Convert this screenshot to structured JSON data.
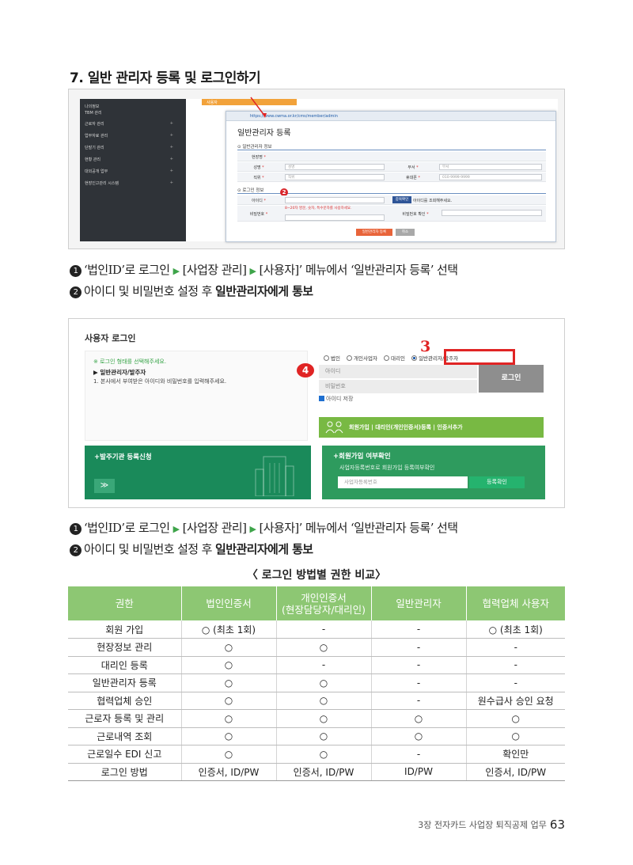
{
  "section_title": "7. 일반 관리자 등록 및 로그인하기",
  "shot1": {
    "sidebar_items": [
      "나의정보",
      "TBM 관리",
      "근로자 관리",
      "업무자료 관리",
      "단말기 관리",
      "현황 관리",
      "대외공개 업무",
      "현장인고관리 시스템"
    ],
    "tab_label": "사용자",
    "url": "https://www.cwma.or.kr/cms/member/admin",
    "window_title": "일반관리자 등록",
    "sec_general": "⊙ 일반관리자 정보",
    "sec_login": "⊙ 로그인 정보",
    "labels": {
      "site": "현장명",
      "name": "성명",
      "dept": "부서",
      "position": "직위",
      "phone": "휴대폰",
      "id": "아이디",
      "password": "비밀번호",
      "password_confirm": "비밀번호 확인"
    },
    "placeholders": {
      "name": "성명",
      "dept": "부서",
      "position": "직위",
      "phone": "010-9999-9999"
    },
    "dup_check": "중복확인",
    "dup_hint": "아이디를 조회해주세요.",
    "pw_rule": "8~20자 영문, 숫자, 특수문자를 사용하세요.",
    "register_button": "일반관리자 등록",
    "cancel_button": "취소",
    "badge2": "2"
  },
  "steps_a": {
    "s1_num": "1",
    "s1_pre": "‘법인ID’로 로그인 ",
    "s1_mid1": " [사업장 관리] ",
    "s1_mid2": " [사용자]’ 메뉴에서 ‘일반관리자 등록’ 선택",
    "s2_num": "2",
    "s2_pre": "아이디 및 비밀번호 설정 후 ",
    "s2_bold": "일반관리자에게 통보"
  },
  "shot2": {
    "title": "사용자 로그인",
    "info_hint": "※ 로그인 형태를 선택해주세요.",
    "info_type": "▶ 일반관리자/발주자",
    "info_desc": "1. 본사에서 부여받은 아이디와 비밀번호를 입력해주세요.",
    "radios": [
      "법인",
      "개인사업자",
      "대리인",
      "일반관리자/발주자"
    ],
    "num3": "3",
    "num4": "4",
    "id_placeholder": "아이디",
    "pw_placeholder": "비밀번호",
    "login_button": "로그인",
    "save_id": "아이디 저장",
    "join_bar": "회원가입 | 대리인(개인인증서)등록 | 인증서추가",
    "order_register": "+발주기관 등록신청",
    "arrow": "≫",
    "join_check_title": "+회원가입 여부확인",
    "join_check_sub": "사업자등록번호로 회원가입 등록여부확인",
    "bizno_placeholder": "사업자등록번호",
    "confirm_button": "등록확인"
  },
  "steps_b": {
    "s1_num": "1",
    "s1_pre": "‘법인ID’로 로그인 ",
    "s1_mid1": " [사업장 관리]  ",
    "s1_mid2": " [사용자]’ 메뉴에서 ‘일반관리자 등록’ 선택",
    "s2_num": "2",
    "s2_pre": "아이디 및 비밀번호 설정 후 ",
    "s2_bold": "일반관리자에게 통보"
  },
  "table": {
    "caption": "〈 로그인 방법별 권한 비교〉",
    "headers": [
      "권한",
      "법인인증서",
      "개인인증서\n(현장담당자/대리인)",
      "일반관리자",
      "협력업체 사용자"
    ],
    "rows": [
      [
        "회원 가입",
        "○ (최초 1회)",
        "-",
        "-",
        "○ (최초 1회)"
      ],
      [
        "현장정보 관리",
        "○",
        "○",
        "-",
        "-"
      ],
      [
        "대리인 등록",
        "○",
        "-",
        "-",
        "-"
      ],
      [
        "일반관리자 등록",
        "○",
        "○",
        "-",
        "-"
      ],
      [
        "협력업체 승인",
        "○",
        "○",
        "-",
        "원수급사 승인 요청"
      ],
      [
        "근로자 등록 및 관리",
        "○",
        "○",
        "○",
        "○"
      ],
      [
        "근로내역 조회",
        "○",
        "○",
        "○",
        "○"
      ],
      [
        "근로일수 EDI 신고",
        "○",
        "○",
        "-",
        "확인만"
      ],
      [
        "로그인 방법",
        "인증서, ID/PW",
        "인증서, ID/PW",
        "ID/PW",
        "인증서, ID/PW"
      ]
    ]
  },
  "footer": {
    "chapter": "3장 전자카드 사업장 퇴직공제 업무",
    "page": "63"
  }
}
